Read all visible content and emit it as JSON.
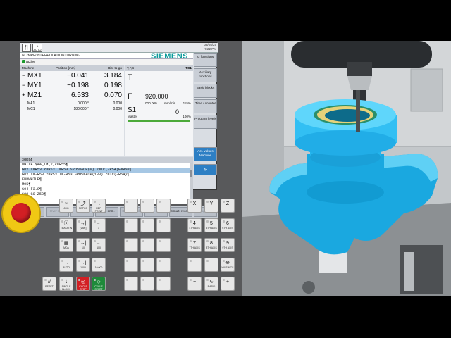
{
  "hmi": {
    "mode_labels": {
      "jog": "",
      "auto": "AUTO"
    },
    "datetime": {
      "date": "03/05/25",
      "time": "7:22 PM"
    },
    "brand": "SIEMENS",
    "program_path": "NC/MPF/INTERPOLATIONTURNING",
    "status_text": "active",
    "axes": {
      "headers": {
        "machine": "Machine",
        "position": "Position [mm]",
        "dist": "Dist-to-go"
      },
      "rows": [
        {
          "sign": "−",
          "name": "MX1",
          "pos": "−0.041",
          "dtg": "3.184"
        },
        {
          "sign": "−",
          "name": "MY1",
          "pos": "−0.198",
          "dtg": "0.198"
        },
        {
          "sign": "+",
          "name": "MZ1",
          "pos": "6.533",
          "dtg": "0.070"
        }
      ],
      "small_rows": [
        {
          "name": "MA1",
          "pos": "0.000 °",
          "dtg": "0.000"
        },
        {
          "name": "MC1",
          "pos": "180.000 °",
          "dtg": "0.000"
        }
      ]
    },
    "tfs": {
      "header": "T,F,S",
      "channel": "TC1",
      "t_label": "T",
      "f_label": "F",
      "f_value": "920.000",
      "f_sub": "000.000",
      "f_unit": "mm/min",
      "f_pct": "115%",
      "s_label": "S1",
      "s_master": "Master",
      "s_value": "0",
      "s_pct": "100%",
      "spindle_percent": 1.0
    },
    "code_header": "3HG54",
    "code_lines": [
      {
        "text": "WHILE $AA_IM[2]<=R55¶",
        "highlight": false
      },
      {
        "text": "G02 X=R53 Y=R53 I=R53 SPOS=ACP(0) Z=IC(-R54)F=R60¶",
        "highlight": true
      },
      {
        "text": "G02 X=-R53 Y=R53 I=-R53 SPOS=ACP(180) Z=IC(-R54)¶",
        "highlight": false
      },
      {
        "text": "ENDWHILE¶",
        "highlight": false
      },
      {
        "text": "M05¶",
        "highlight": false
      },
      {
        "text": "G04 F3.0¶",
        "highlight": false
      },
      {
        "text": "G00 G0 Z50¶",
        "highlight": false
      },
      {
        "text": "M30¶",
        "highlight": false
      }
    ],
    "vertical_softkeys": [
      {
        "label": "G functions",
        "active": false
      },
      {
        "label": "Auxiliary functions",
        "active": false
      },
      {
        "label": "Basic blocks",
        "active": false
      },
      {
        "label": "Time / counter",
        "active": false
      },
      {
        "label": "Program levels",
        "active": false
      },
      {
        "label": "Act. values Machine",
        "active": true
      },
      {
        "label": "»",
        "active": true
      }
    ],
    "horizontal_softkeys": [
      {
        "label": "",
        "dim": true
      },
      {
        "label": "Over-store",
        "dim": true
      },
      {
        "label": "",
        "dim": true
      },
      {
        "label": "Prog. cntrl.",
        "dim": false
      },
      {
        "label": "Block search",
        "dim": true
      },
      {
        "label": "",
        "dim": true
      },
      {
        "label": "Simult. record.",
        "dim": false
      },
      {
        "label": "Prog. corr.",
        "dim": true
      }
    ]
  },
  "mcp": {
    "left_keys": [
      {
        "id": "jog",
        "glyph": "≈",
        "text": "JOG"
      },
      {
        "id": "repos",
        "glyph": "⤴",
        "text": "REPOS"
      },
      {
        "id": "ref",
        "glyph": "→",
        "text": "REF. POINT"
      },
      {
        "id": "teach",
        "glyph": "⦿",
        "text": "TEACH IN"
      },
      {
        "id": "var",
        "glyph": "→|",
        "text": "[VAR]"
      },
      {
        "id": "inc1",
        "glyph": "→|",
        "text": "1"
      },
      {
        "id": "mda",
        "glyph": "▦",
        "text": "MDA"
      },
      {
        "id": "inc10",
        "glyph": "→|",
        "text": "10"
      },
      {
        "id": "inc100",
        "glyph": "→|",
        "text": "100"
      },
      {
        "id": "auto",
        "glyph": "→",
        "text": "AUTO"
      },
      {
        "id": "inc1000",
        "glyph": "→|",
        "text": "1000"
      },
      {
        "id": "inc10000",
        "glyph": "→|",
        "text": "10 000"
      },
      {
        "id": "reset",
        "glyph": "//",
        "text": "RESET"
      },
      {
        "id": "single",
        "glyph": "⇣",
        "text": "SINGLE BLOCK"
      },
      {
        "id": "cycstop",
        "glyph": "◎",
        "text": "CYCLE STOP"
      },
      {
        "id": "cycstart",
        "glyph": "◇",
        "text": "CYCLE START"
      }
    ],
    "axis_keys": [
      {
        "id": "x",
        "glyph": "X",
        "text": ""
      },
      {
        "id": "y",
        "glyph": "Y",
        "text": ""
      },
      {
        "id": "z",
        "glyph": "Z",
        "text": ""
      },
      {
        "id": "ax4",
        "glyph": "4",
        "text": "4TH AXIS"
      },
      {
        "id": "ax5",
        "glyph": "5",
        "text": "5TH AXIS"
      },
      {
        "id": "ax6",
        "glyph": "6",
        "text": "6TH AXIS"
      },
      {
        "id": "ax7",
        "glyph": "7",
        "text": "7TH AXIS"
      },
      {
        "id": "ax8",
        "glyph": "8",
        "text": "8TH AXIS"
      },
      {
        "id": "ax9",
        "glyph": "9",
        "text": "9TH AXIS"
      },
      {
        "id": "blank1",
        "glyph": "",
        "text": ""
      },
      {
        "id": "blank2",
        "glyph": "",
        "text": ""
      },
      {
        "id": "wcsmcs",
        "glyph": "⊕",
        "text": "WCS MCS"
      },
      {
        "id": "minus",
        "glyph": "−",
        "text": ""
      },
      {
        "id": "rapid",
        "glyph": "∿",
        "text": "RAPID"
      },
      {
        "id": "plus",
        "glyph": "+",
        "text": ""
      }
    ]
  },
  "colors": {
    "brand": "#0a9a9a",
    "active_softkey": "#2d7fc4",
    "part": "#1fb4ec",
    "estop_ring": "#f0c814",
    "estop_button": "#d21f24"
  }
}
